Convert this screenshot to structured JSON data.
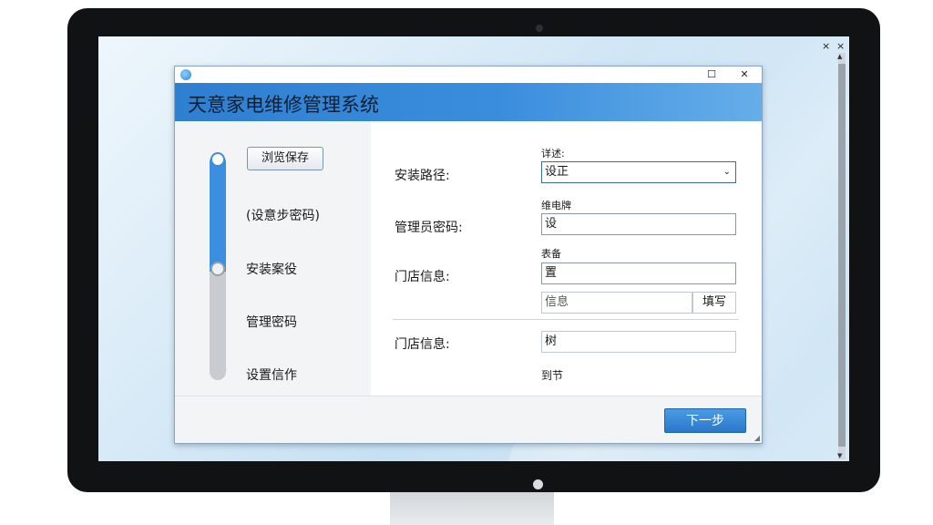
{
  "screen": {
    "close_labels": [
      "×",
      "×"
    ]
  },
  "window": {
    "title": "天意家电维修管理系统",
    "controls": {
      "maximize": "☐",
      "close": "✕"
    }
  },
  "left": {
    "browse_button": "浏览保存",
    "steps": [
      "(设意步密码)",
      "安装案役",
      "管理密码",
      "设置信作"
    ]
  },
  "form": {
    "labels": [
      "安装路径:",
      "管理员密码:",
      "门店信息:",
      "门店信息:"
    ],
    "hints": [
      "详述:",
      "维电牌",
      "表备",
      "到节"
    ],
    "fields": {
      "path_value": "设正",
      "password_value": "设",
      "store_value": "置",
      "info_placeholder": "信息",
      "info_button": "填写",
      "store2_value": "树"
    }
  },
  "footer": {
    "next_button": "下一步"
  }
}
